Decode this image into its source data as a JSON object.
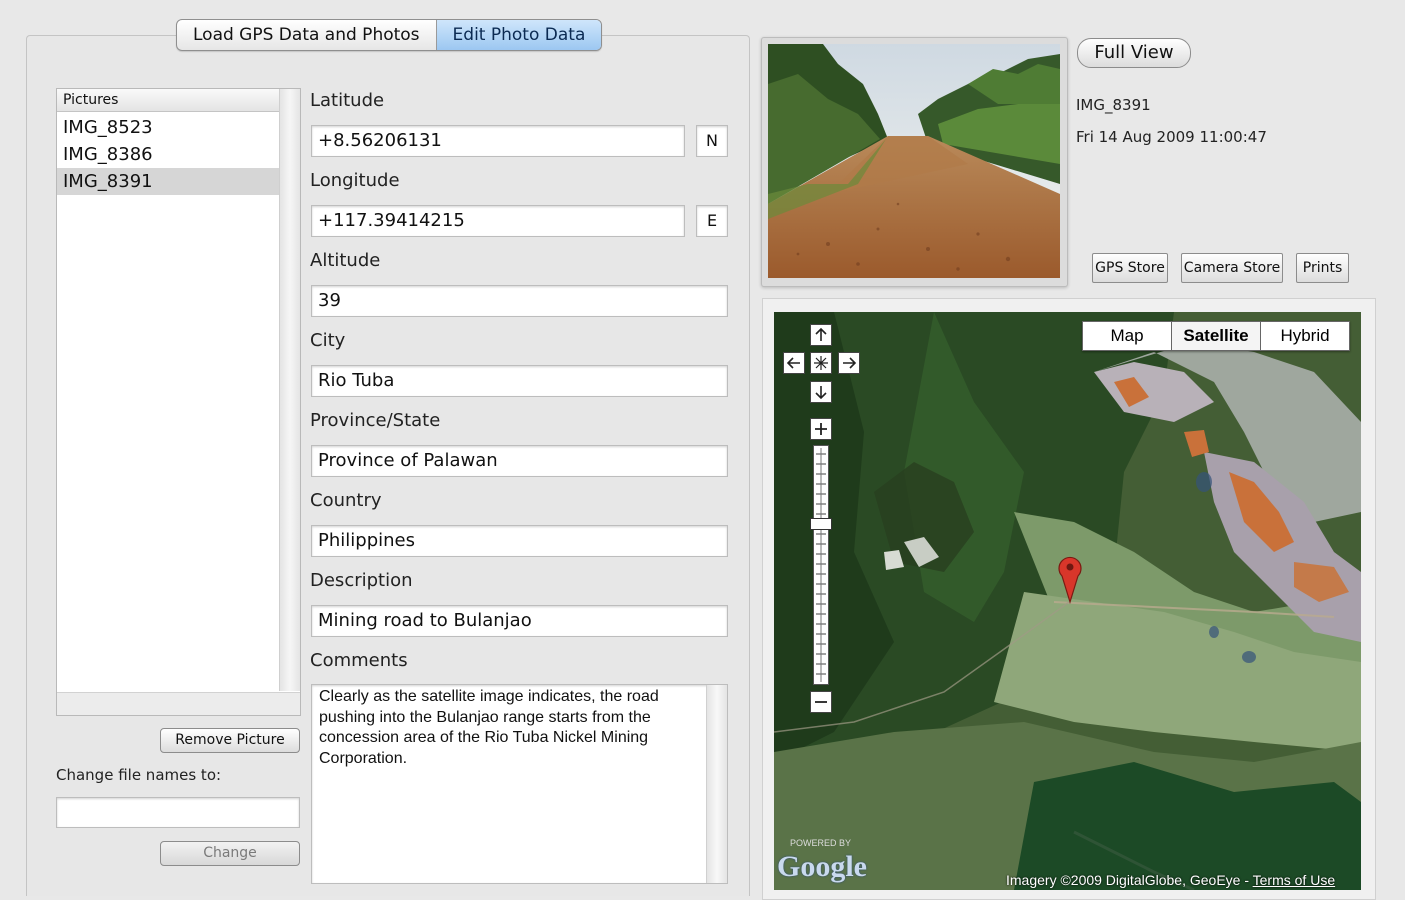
{
  "tabs": [
    {
      "label": "Load GPS Data and Photos",
      "active": false
    },
    {
      "label": "Edit Photo Data",
      "active": true
    }
  ],
  "pictures": {
    "header": "Pictures",
    "items": [
      "IMG_8523",
      "IMG_8386",
      "IMG_8391"
    ],
    "selected": "IMG_8391"
  },
  "remove_button": "Remove Picture",
  "rename": {
    "label": "Change file names to:",
    "value": "",
    "button": "Change"
  },
  "form": {
    "latitude_label": "Latitude",
    "latitude": "+8.56206131",
    "latitude_dir": "N",
    "longitude_label": "Longitude",
    "longitude": "+117.39414215",
    "longitude_dir": "E",
    "altitude_label": "Altitude",
    "altitude": "39",
    "city_label": "City",
    "city": "Rio Tuba",
    "province_label": "Province/State",
    "province": "Province of Palawan",
    "country_label": "Country",
    "country": "Philippines",
    "description_label": "Description",
    "description": "Mining road to Bulanjao",
    "comments_label": "Comments",
    "comments": "Clearly as the satellite image indicates, the road pushing into the Bulanjao range starts from the concession area of the Rio Tuba Nickel Mining Corporation."
  },
  "photo": {
    "full_view": "Full View",
    "name": "IMG_8391",
    "date": "Fri 14 Aug 2009 11:00:47"
  },
  "store_buttons": [
    "GPS Store",
    "Camera Store",
    "Prints"
  ],
  "map": {
    "types": [
      "Map",
      "Satellite",
      "Hybrid"
    ],
    "active_type": "Satellite",
    "logo": "Google",
    "powered_by": "POWERED BY",
    "attribution": "Imagery ©2009 DigitalGlobe, GeoEye - ",
    "terms": "Terms of Use"
  },
  "colors": {
    "selected_tab": "#9cc7f1",
    "marker": "#d8362a",
    "accent": "#0b2a52"
  }
}
